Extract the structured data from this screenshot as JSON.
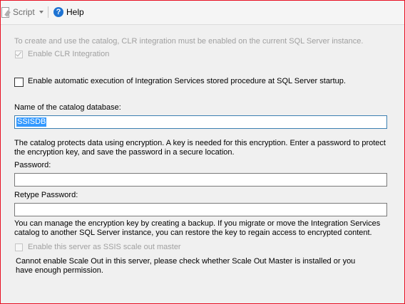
{
  "toolbar": {
    "script_label": "Script",
    "help_label": "Help"
  },
  "clr": {
    "note": "To create and use the catalog, CLR integration must be enabled on the current SQL Server instance.",
    "checkbox_label": "Enable CLR Integration",
    "checked": true,
    "enabled": false
  },
  "auto_exec": {
    "checkbox_label": "Enable automatic execution of Integration Services stored procedure at SQL Server startup.",
    "checked": false
  },
  "catalog": {
    "label": "Name of the catalog database:",
    "value": "SSISDB"
  },
  "encryption": {
    "note": "The catalog protects data using encryption. A key is needed for this encryption. Enter a password to protect the encryption key, and save the password in a secure location.",
    "password_label": "Password:",
    "password_value": "",
    "retype_label": "Retype Password:",
    "retype_value": ""
  },
  "backup": {
    "note": "You can manage the encryption key by creating a backup. If you migrate or move the Integration Services catalog to another SQL Server instance, you can restore the key to regain access to encrypted content."
  },
  "scale_out": {
    "checkbox_label": "Enable this server as SSIS scale out master",
    "checked": false,
    "enabled": false,
    "warning": "Cannot enable Scale Out in this server, please check whether Scale Out Master is installed or you have enough permission."
  }
}
